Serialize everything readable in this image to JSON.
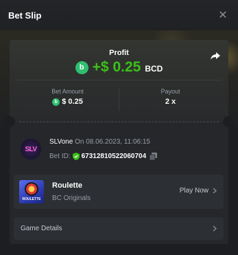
{
  "header": {
    "title": "Bet Slip",
    "close_glyph": "✕"
  },
  "profit": {
    "label": "Profit",
    "value": "+$ 0.25",
    "currency": "BCD",
    "coin_glyph": "b"
  },
  "stats": {
    "bet_amount_label": "Bet Amount",
    "bet_amount_value": "$ 0.25",
    "payout_label": "Payout",
    "payout_value": "2 x"
  },
  "user": {
    "avatar_text": "SLV",
    "name": "SLVone",
    "date_prefix": "On",
    "date": "08.06.2023, 11:06:15",
    "bet_id_label": "Bet ID:",
    "bet_id": "67312810522060704"
  },
  "game": {
    "name": "Roulette",
    "provider": "BC Originals",
    "thumb_text": "ROULETTE",
    "play_label": "Play Now"
  },
  "details": {
    "label": "Game Details"
  },
  "colors": {
    "accent_green": "#3bc117",
    "coin_green": "#2fbf71",
    "background": "#1c1e22",
    "card": "#25272b"
  }
}
